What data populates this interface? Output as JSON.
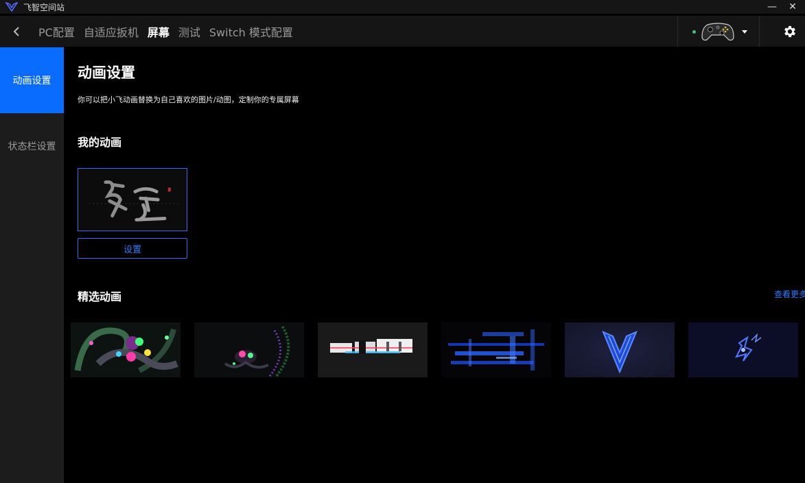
{
  "window": {
    "title": "飞智空间站",
    "minimize_glyph": "—",
    "close_glyph": "✕"
  },
  "nav": {
    "tabs": [
      {
        "label": "PC配置",
        "active": false
      },
      {
        "label": "自适应扳机",
        "active": false
      },
      {
        "label": "屏幕",
        "active": true
      },
      {
        "label": "测试",
        "active": false
      },
      {
        "label": "Switch 模式配置",
        "active": false
      }
    ],
    "device_status_color": "#3ac47d"
  },
  "sidebar": {
    "items": [
      {
        "label": "动画设置",
        "active": true
      },
      {
        "label": "状态栏设置",
        "active": false
      }
    ]
  },
  "main": {
    "title": "动画设置",
    "description": "你可以把小飞动画替换为自己喜欢的图片/动图，定制你的专属屏幕",
    "my_animation": {
      "title": "我的动画",
      "set_button": "设置"
    },
    "featured": {
      "title": "精选动画",
      "view_more": "查看更多"
    }
  },
  "colors": {
    "accent": "#0a6cff",
    "link": "#2f7bff",
    "background": "#000000",
    "sidebar": "#1c1c1c"
  }
}
